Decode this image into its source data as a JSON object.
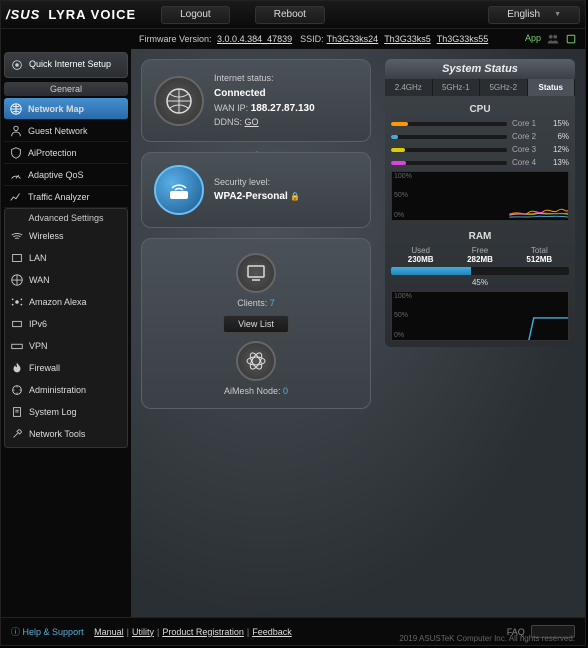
{
  "header": {
    "brand": "/SUS",
    "product": "LYRA VOICE",
    "logout": "Logout",
    "reboot": "Reboot",
    "language": "English"
  },
  "infobar": {
    "fw_label": "Firmware Version:",
    "fw_value": "3.0.0.4.384_47839",
    "ssid_label": "SSID:",
    "ssids": [
      "Th3G33ks24",
      "Th3G33ks5",
      "Th3G33ks55"
    ],
    "app": "App"
  },
  "sidebar": {
    "quick": "Quick Internet Setup",
    "general_hdr": "General",
    "general": [
      "Network Map",
      "Guest Network",
      "AiProtection",
      "Adaptive QoS",
      "Traffic Analyzer"
    ],
    "adv_hdr": "Advanced Settings",
    "adv": [
      "Wireless",
      "LAN",
      "WAN",
      "Amazon Alexa",
      "IPv6",
      "VPN",
      "Firewall",
      "Administration",
      "System Log",
      "Network Tools"
    ]
  },
  "status": {
    "internet": {
      "label": "Internet status:",
      "value": "Connected",
      "wan_label": "WAN IP:",
      "wan_ip": "188.27.87.130",
      "ddns_label": "DDNS:",
      "ddns": "GO"
    },
    "security": {
      "label": "Security level:",
      "value": "WPA2-Personal"
    },
    "clients": {
      "label": "Clients:",
      "count": "7",
      "viewlist": "View List"
    },
    "aimesh": {
      "label": "AiMesh Node:",
      "count": "0"
    }
  },
  "system": {
    "title": "System Status",
    "tabs": [
      "2.4GHz",
      "5GHz-1",
      "5GHz-2",
      "Status"
    ],
    "cpu": {
      "title": "CPU",
      "cores": [
        {
          "label": "Core 1",
          "pct": "15%",
          "w": 15,
          "cls": "c1"
        },
        {
          "label": "Core 2",
          "pct": "6%",
          "w": 6,
          "cls": "c2"
        },
        {
          "label": "Core 3",
          "pct": "12%",
          "w": 12,
          "cls": "c3"
        },
        {
          "label": "Core 4",
          "pct": "13%",
          "w": 13,
          "cls": "c4"
        }
      ]
    },
    "ram": {
      "title": "RAM",
      "used_l": "Used",
      "used": "230MB",
      "free_l": "Free",
      "free": "282MB",
      "total_l": "Total",
      "total": "512MB",
      "pct": "45%",
      "w": 45
    }
  },
  "footer": {
    "help": "Help & Support",
    "links": [
      "Manual",
      "Utility",
      "Product Registration",
      "Feedback"
    ],
    "faq": "FAQ",
    "copy": "2019 ASUSTeK Computer Inc. All rights reserved."
  },
  "chart_data": {
    "cpu_graph": {
      "type": "line",
      "ylim": [
        0,
        100
      ],
      "y_ticks": [
        "100%",
        "50%",
        "0%"
      ],
      "series": [
        {
          "name": "Core 1",
          "color": "#f90",
          "values": [
            10,
            14,
            12,
            18,
            15,
            11,
            16,
            15
          ]
        },
        {
          "name": "Core 2",
          "color": "#4ad",
          "values": [
            5,
            7,
            4,
            8,
            6,
            5,
            7,
            6
          ]
        },
        {
          "name": "Core 3",
          "color": "#dc0",
          "values": [
            9,
            11,
            13,
            10,
            14,
            12,
            9,
            12
          ]
        },
        {
          "name": "Core 4",
          "color": "#d4d",
          "values": [
            12,
            10,
            14,
            11,
            15,
            13,
            12,
            13
          ]
        }
      ]
    },
    "ram_graph": {
      "type": "line",
      "ylim": [
        0,
        100
      ],
      "y_ticks": [
        "100%",
        "50%",
        "0%"
      ],
      "series": [
        {
          "name": "RAM",
          "color": "#4ad",
          "values": [
            0,
            0,
            0,
            0,
            0,
            0,
            45,
            45,
            45,
            45
          ]
        }
      ]
    }
  }
}
